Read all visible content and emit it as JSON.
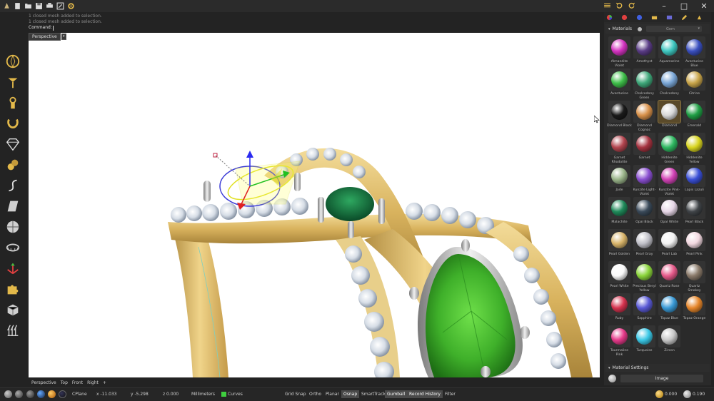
{
  "command": {
    "history": [
      "1 closed mesh added to selection.",
      "1 closed mesh added to selection."
    ],
    "prompt": "Command:"
  },
  "viewport": {
    "label": "Perspective"
  },
  "view_tabs": [
    "Perspective",
    "Top",
    "Front",
    "Right",
    "+"
  ],
  "status": {
    "cplane": "CPlane",
    "x": "x -11.033",
    "y": "y -5.298",
    "z": "z 0.000",
    "units": "Millimeters",
    "layer": "Curves",
    "grid_snap": "Grid Snap",
    "ortho": "Ortho",
    "planar": "Planar",
    "osnap": "Osnap",
    "smarttrack": "SmartTrack",
    "gumball": "Gumball",
    "record_history": "Record History",
    "filter": "Filter",
    "value1": "0.000",
    "value2": "0.190"
  },
  "materials_panel": {
    "title": "Materials",
    "filter_value": "Gem",
    "settings_title": "Material Settings",
    "settings_button": "Image",
    "selected": "Diamond",
    "items": [
      {
        "name": "Almandite Violet",
        "color": "#d433c0"
      },
      {
        "name": "Amethyst",
        "color": "#5a3c86"
      },
      {
        "name": "Aquamarine",
        "color": "#3ec7c0"
      },
      {
        "name": "Aventurine Blue",
        "color": "#3a4fbf"
      },
      {
        "name": "Aventurine",
        "color": "#3fc04a"
      },
      {
        "name": "Chalcedony Green",
        "color": "#3fa87a"
      },
      {
        "name": "Chalcedony",
        "color": "#7aa6d6"
      },
      {
        "name": "Citrine",
        "color": "#c9a54a"
      },
      {
        "name": "Diamond Black",
        "color": "#1a1a1a"
      },
      {
        "name": "Diamond Cognac",
        "color": "#d8914a"
      },
      {
        "name": "Diamond",
        "color": "#d8d8d8"
      },
      {
        "name": "Emerald",
        "color": "#1f9f45"
      },
      {
        "name": "Garnet Rhodolite",
        "color": "#b3454f"
      },
      {
        "name": "Garnet",
        "color": "#a63340"
      },
      {
        "name": "Hiddenite Green",
        "color": "#2fb861"
      },
      {
        "name": "Hiddenite Yellow",
        "color": "#d8d41f"
      },
      {
        "name": "Jade",
        "color": "#9ab58a"
      },
      {
        "name": "Kunzite Light-Violet",
        "color": "#8a4fd1"
      },
      {
        "name": "Kunzite Pink-Violet",
        "color": "#d243b6"
      },
      {
        "name": "Lapis Lazuli",
        "color": "#3a4fd6"
      },
      {
        "name": "Malachite",
        "color": "#1f8a5a"
      },
      {
        "name": "Opal Black",
        "color": "#3a4a5a"
      },
      {
        "name": "Opal White",
        "color": "#e6d6e6"
      },
      {
        "name": "Pearl Black",
        "color": "#404448"
      },
      {
        "name": "Pearl Golden",
        "color": "#d8b46a"
      },
      {
        "name": "Pearl Gray",
        "color": "#c0c0c8"
      },
      {
        "name": "Pearl Lab",
        "color": "#f2f2f2"
      },
      {
        "name": "Pearl Pink",
        "color": "#f2d8e0"
      },
      {
        "name": "Pearl White",
        "color": "#fafafa"
      },
      {
        "name": "Precious Beryl Yellow",
        "color": "#8ad43a"
      },
      {
        "name": "Quartz Rose",
        "color": "#e65a8a"
      },
      {
        "name": "Quartz Smokey",
        "color": "#8a7a6a"
      },
      {
        "name": "Ruby",
        "color": "#d6334f"
      },
      {
        "name": "Sapphire",
        "color": "#5a5ad6"
      },
      {
        "name": "Topaz Blue",
        "color": "#3a9ad6"
      },
      {
        "name": "Topaz Orange",
        "color": "#e6862a"
      },
      {
        "name": "Tourmaline Pink",
        "color": "#e63a8a"
      },
      {
        "name": "Turquoise",
        "color": "#3ac8e6"
      },
      {
        "name": "Zircon",
        "color": "#c8c8c8"
      }
    ]
  },
  "colors": {
    "gold": "#d9b35e",
    "emerald_light": "#3fbf2f",
    "emerald_dark": "#0c6b3a",
    "panel_bg": "#2a2a2a"
  }
}
